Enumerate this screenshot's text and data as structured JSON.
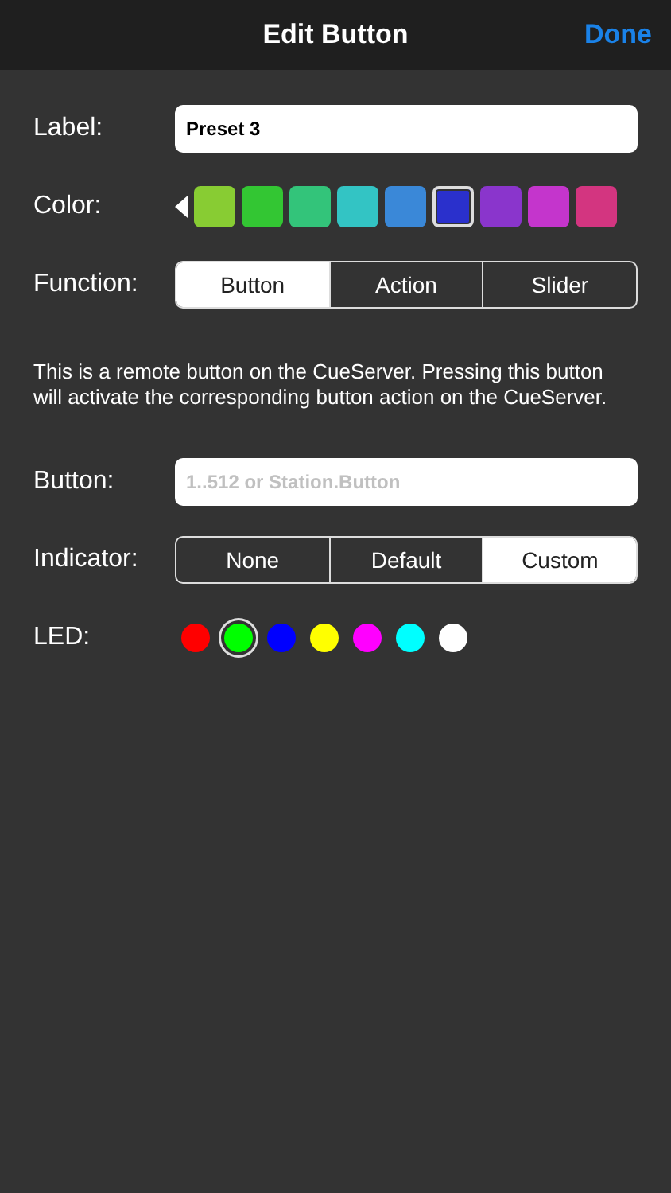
{
  "navigation_bar": {
    "title": "Edit Button",
    "done_button": "Done"
  },
  "label_row": {
    "label": "Label:",
    "value": "Preset 3"
  },
  "color_row": {
    "label": "Color:",
    "swatches": [
      {
        "color": "#88cc33",
        "selected": false
      },
      {
        "color": "#33c633",
        "selected": false
      },
      {
        "color": "#33c47a",
        "selected": false
      },
      {
        "color": "#33c4c4",
        "selected": false
      },
      {
        "color": "#3a88d8",
        "selected": false
      },
      {
        "color": "#2a30cc",
        "selected": true
      },
      {
        "color": "#8a35cc",
        "selected": false
      },
      {
        "color": "#c435cc",
        "selected": false
      },
      {
        "color": "#d33580",
        "selected": false
      }
    ]
  },
  "function_row": {
    "label": "Function:",
    "segments": [
      {
        "label": "Button",
        "selected": true
      },
      {
        "label": "Action",
        "selected": false
      },
      {
        "label": "Slider",
        "selected": false
      }
    ]
  },
  "description": "This is a remote button on the CueServer.  Pressing this button will activate the corresponding button action on the CueServer.",
  "button_row": {
    "label": "Button:",
    "placeholder": "1..512 or Station.Button"
  },
  "indicator_row": {
    "label": "Indicator:",
    "segments": [
      {
        "label": "None",
        "selected": false
      },
      {
        "label": "Default",
        "selected": false
      },
      {
        "label": "Custom",
        "selected": true
      }
    ]
  },
  "led_row": {
    "label": "LED:",
    "leds": [
      {
        "color": "#ff0000",
        "selected": false
      },
      {
        "color": "#00ff00",
        "selected": true
      },
      {
        "color": "#0000ff",
        "selected": false
      },
      {
        "color": "#ffff00",
        "selected": false
      },
      {
        "color": "#ff00ff",
        "selected": false
      },
      {
        "color": "#00ffff",
        "selected": false
      },
      {
        "color": "#ffffff",
        "selected": false
      }
    ]
  }
}
